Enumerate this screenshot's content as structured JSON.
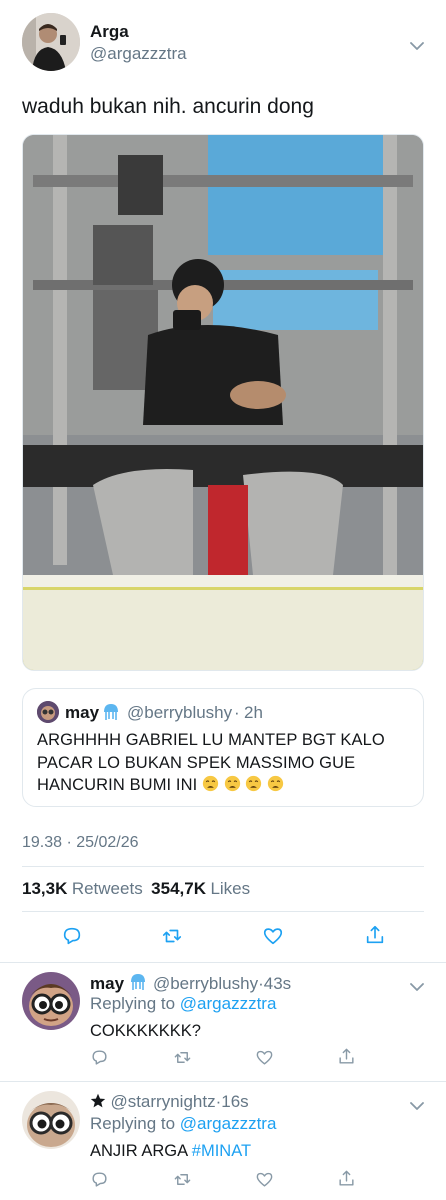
{
  "tweet": {
    "author": {
      "name": "Arga",
      "handle": "@argazzztra",
      "avatar_icon": "user-avatar"
    },
    "text": "waduh bukan nih. ancurin dong",
    "image_alt": "gym mirror selfie photo",
    "quoted": {
      "name": "may",
      "handle": "@berryblushy",
      "dot": "·",
      "time": "2h",
      "text": "ARGHHHH GABRIEL LU MANTEP BGT KALO PACAR LO BUKAN SPEK MASSIMO GUE HANCURIN BUMI INI",
      "trailing_emoji": [
        "weary-face",
        "weary-face",
        "weary-face",
        "weary-face"
      ]
    },
    "timestamp": "19.38 · 25/02/26",
    "stats": {
      "retweets_count": "13,3K",
      "retweets_label": "Retweets",
      "likes_count": "354,7K",
      "likes_label": "Likes"
    }
  },
  "replies": [
    {
      "name": "may",
      "handle": "@berryblushy",
      "dot": "·",
      "time": "43s",
      "replying_prefix": "Replying to",
      "replying_to": "@argazzztra",
      "text": "COKKKKKKK?",
      "avatar_icon": "cartoon-glasses-avatar"
    },
    {
      "name_icon": "star-icon",
      "handle": "@starrynightz",
      "dot": "·",
      "time": "16s",
      "replying_prefix": "Replying to",
      "replying_to": "@argazzztra",
      "text_plain": "ANJIR ARGA",
      "text_hashtag": "#MINAT",
      "avatar_icon": "cartoon-glasses-avatar"
    }
  ],
  "colors": {
    "link_blue": "#1da1f2",
    "muted_gray": "#657786",
    "divider": "#e1e8ed",
    "text": "#14171a"
  }
}
